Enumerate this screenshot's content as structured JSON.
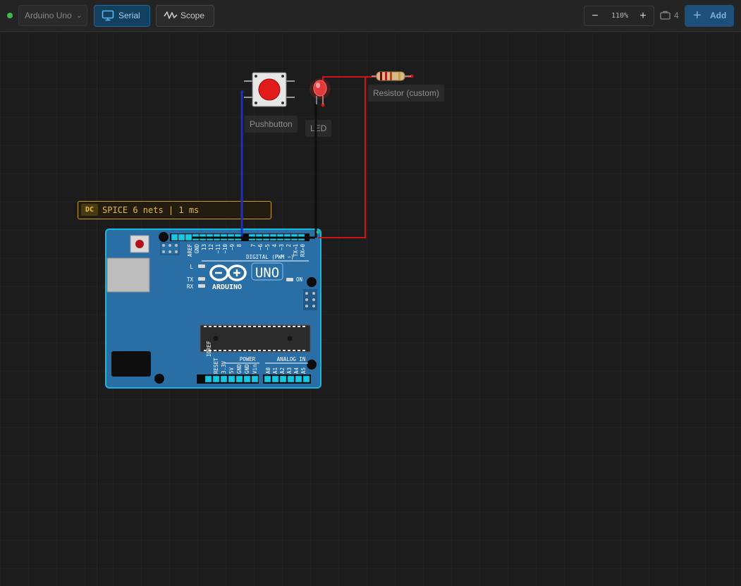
{
  "toolbar": {
    "board_select": "Arduino Uno",
    "serial_label": "Serial",
    "scope_label": "Scope",
    "zoom_level": "110%",
    "zoom_out": "−",
    "zoom_in": "+",
    "component_count": "4",
    "add_label": "Add"
  },
  "canvas": {
    "spice_badge": "DC",
    "spice_status": "SPICE 6 nets | 1 ms",
    "components": {
      "pushbutton": "Pushbutton",
      "led": "LED",
      "resistor": "Resistor (custom)"
    }
  },
  "arduino": {
    "uno_text": "UNO",
    "brand_text": "ARDUINO",
    "digital_header": "DIGITAL (PWM ~)",
    "power_header": "POWER",
    "analog_header": "ANALOG IN",
    "on_label": "ON",
    "l_label": "L",
    "tx_label": "TX",
    "rx_label": "RX",
    "digital_pins": [
      "AREF",
      "GND",
      "13",
      "12",
      "~11",
      "~10",
      "~9",
      "8",
      "7",
      "~6",
      "~5",
      "4",
      "~3",
      "2",
      "TX→1",
      "RX←0"
    ],
    "power_pins": [
      "IOREF",
      "RESET",
      "3.3V",
      "5V",
      "GND",
      "GND",
      "Vin"
    ],
    "analog_pins": [
      "A0",
      "A1",
      "A2",
      "A3",
      "A4",
      "A5"
    ]
  },
  "colors": {
    "accent": "#1d6a99",
    "board_blue": "#2a6ea6",
    "header_cyan": "#15c8e3",
    "wire_blue": "#1f2fb8",
    "wire_black": "#0d0d0d",
    "wire_red": "#d01414",
    "spice_gold": "#c99a25",
    "status_green": "#3fb950"
  },
  "icons": {
    "serial": "monitor-icon",
    "scope": "waveform-icon",
    "components": "briefcase-icon",
    "add": "plus-icon"
  }
}
